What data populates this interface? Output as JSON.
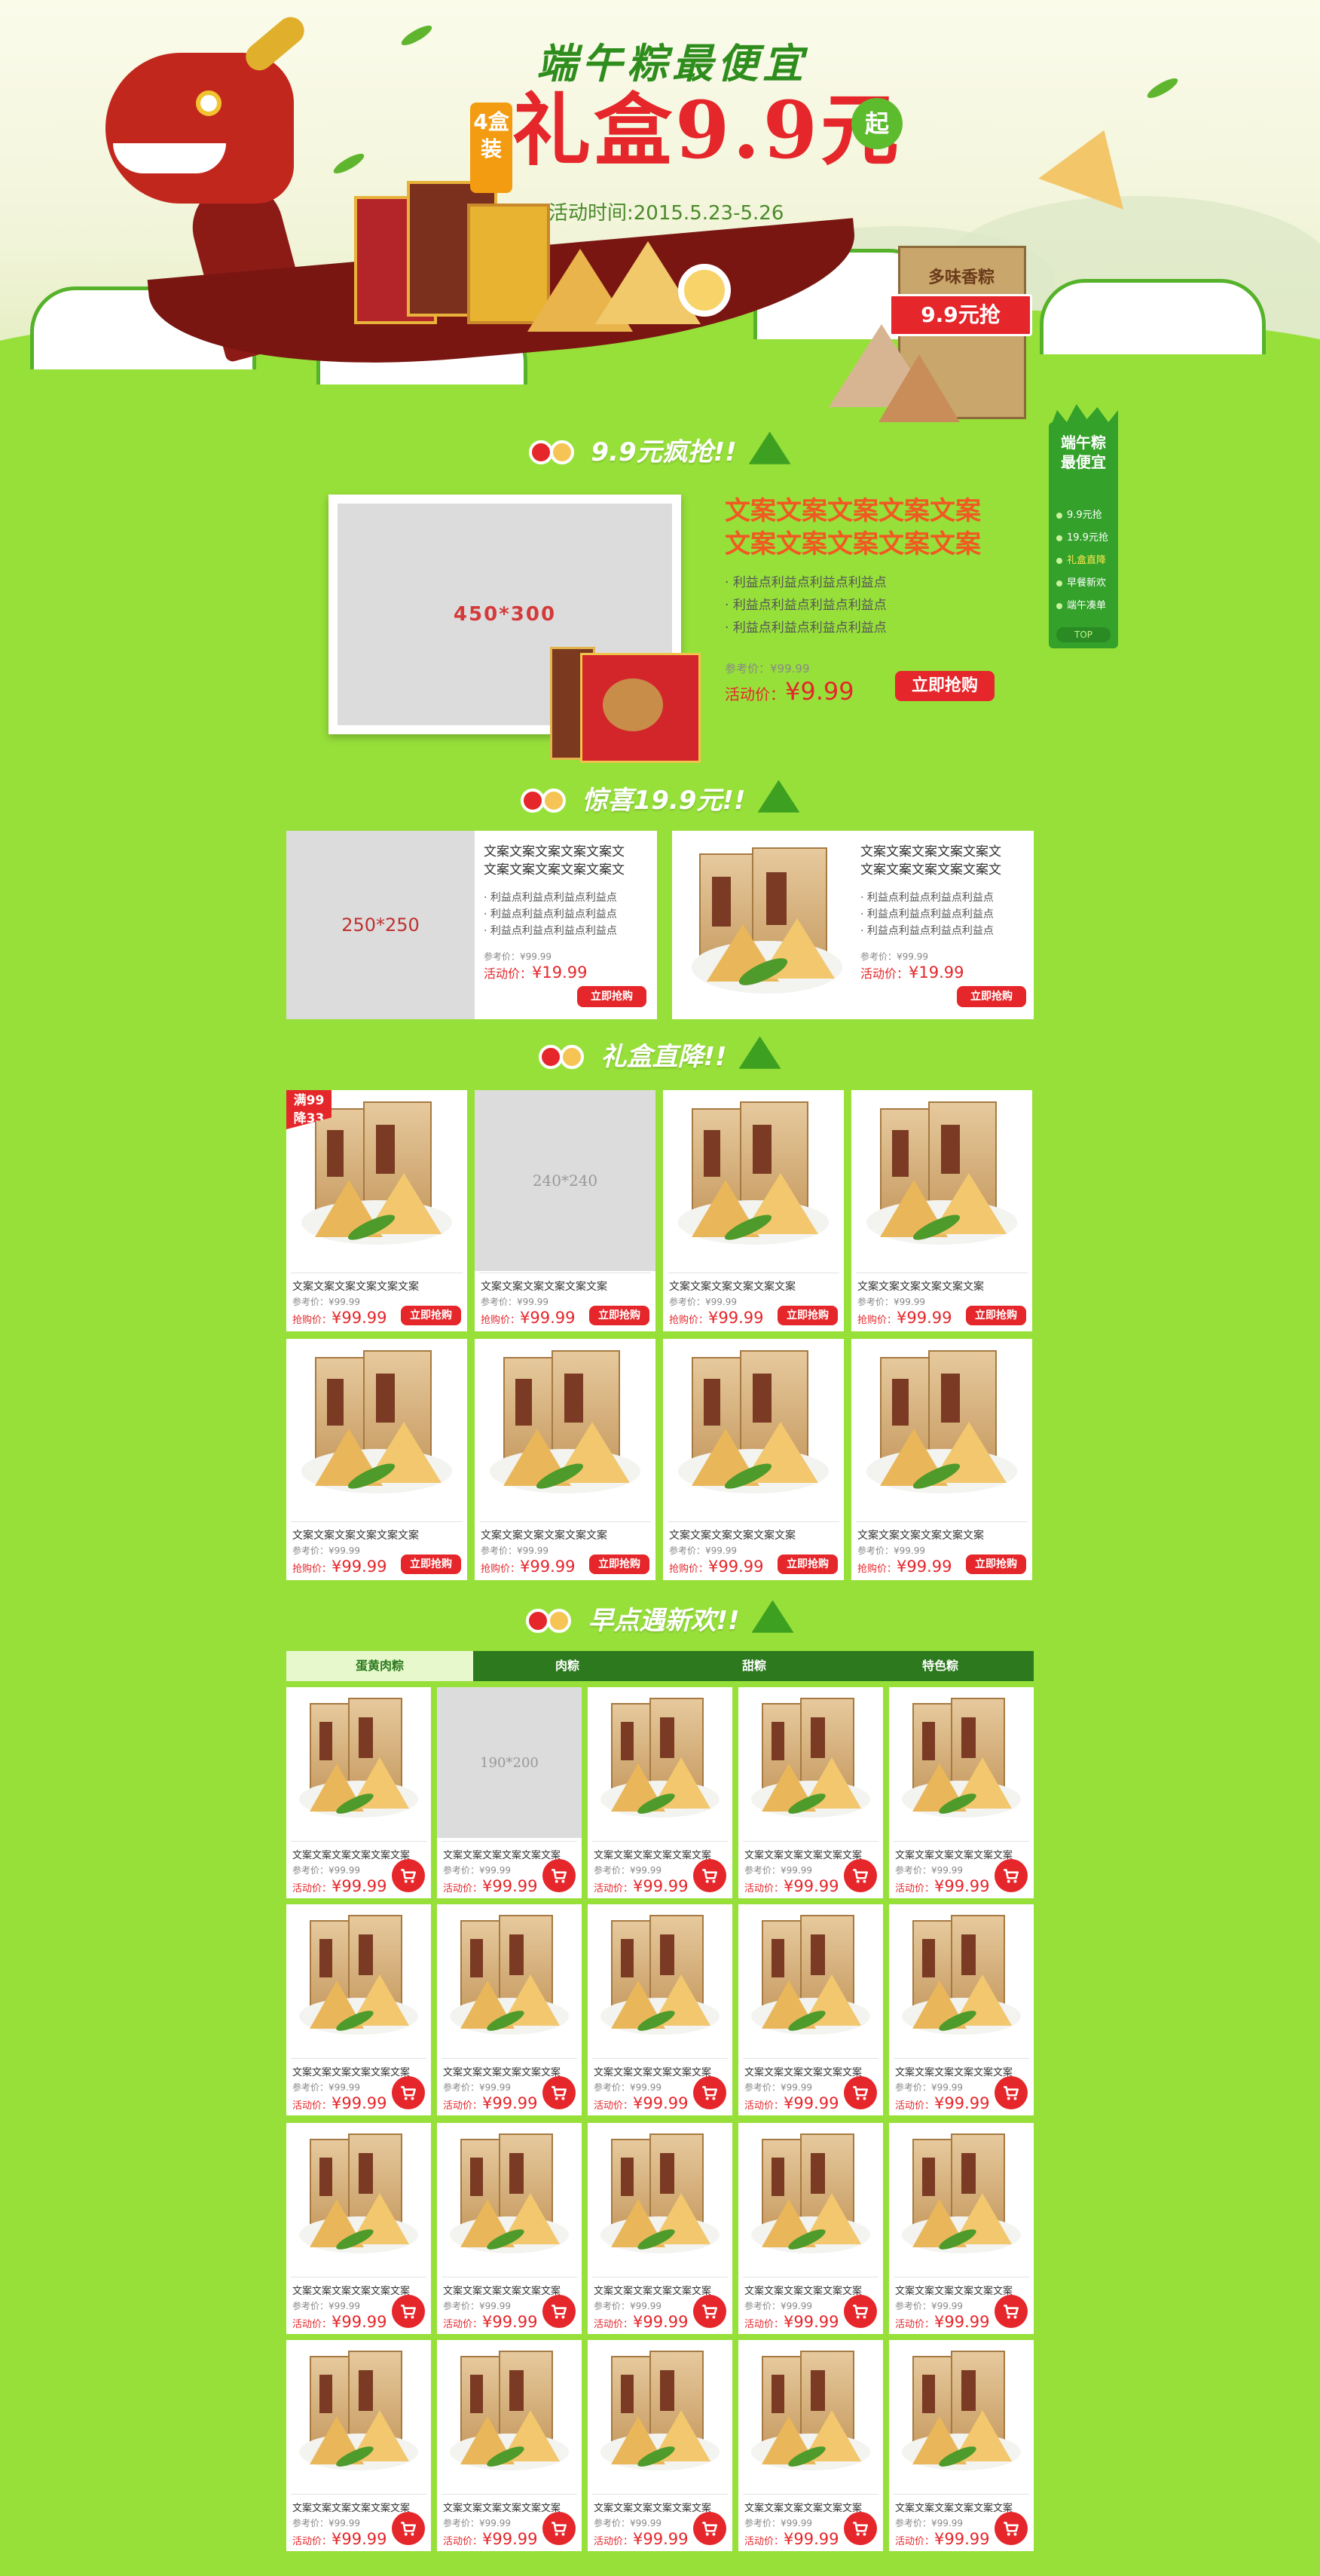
{
  "hero": {
    "slogan": "端午粽最便宜",
    "main": "礼盒9.9元",
    "badge": "4盒装",
    "qi": "起",
    "date": "活动时间:2015.5.23-5.26",
    "box_label": "多味香粽",
    "box_tag": "9.9元抢"
  },
  "sidenav": {
    "title_line1": "端午粽",
    "title_line2": "最便宜",
    "items": [
      "9.9元抢",
      "19.9元抢",
      "礼盒直降",
      "早餐新欢",
      "端午凑单"
    ],
    "top": "TOP"
  },
  "sections": {
    "s1": "9.9元疯抢!!",
    "s2": "惊喜19.9元!!",
    "s3": "礼盒直降!!",
    "s4": "早点遇新欢!!"
  },
  "feature": {
    "placeholder": "450*300",
    "headline1": "文案文案文案文案文案",
    "headline2": "文案文案文案文案文案",
    "bullets": [
      "利益点利益点利益点利益点",
      "利益点利益点利益点利益点",
      "利益点利益点利益点利益点"
    ],
    "ref": "参考价：¥99.99",
    "act_label": "活动价：",
    "act_price": "¥9.99",
    "btn": "立即抢购"
  },
  "duo": [
    {
      "placeholder": "250*250",
      "title1": "文案文案文案文案文案文",
      "title2": "文案文案文案文案文案文",
      "bullets": [
        "利益点利益点利益点利益点",
        "利益点利益点利益点利益点",
        "利益点利益点利益点利益点"
      ],
      "ref": "参考价：¥99.99",
      "act_label": "活动价：",
      "act_price": "¥19.99",
      "btn": "立即抢购"
    },
    {
      "placeholder": "",
      "title1": "文案文案文案文案文案文",
      "title2": "文案文案文案文案文案文",
      "bullets": [
        "利益点利益点利益点利益点",
        "利益点利益点利益点利益点",
        "利益点利益点利益点利益点"
      ],
      "ref": "参考价：¥99.99",
      "act_label": "活动价：",
      "act_price": "¥19.99",
      "btn": "立即抢购"
    }
  ],
  "grid4": {
    "badge": "满99降33",
    "placeholder": "240*240",
    "caption": "文案文案文案文案文案文案",
    "ref": "参考价：¥99.99",
    "act_label": "抢购价：",
    "act_price": "¥99.99",
    "btn": "立即抢购"
  },
  "tabs": [
    "蛋黄肉粽",
    "肉粽",
    "甜粽",
    "特色粽"
  ],
  "grid5": {
    "placeholder": "190*200",
    "caption": "文案文案文案文案文案文案",
    "ref": "参考价：¥99.99",
    "act_label": "活动价：",
    "act_price": "¥99.99"
  },
  "colors": {
    "bg": "#97e03a",
    "red": "#e5262a",
    "tab_dark": "#2d7a1e",
    "tab_light": "#e6f8cc"
  }
}
